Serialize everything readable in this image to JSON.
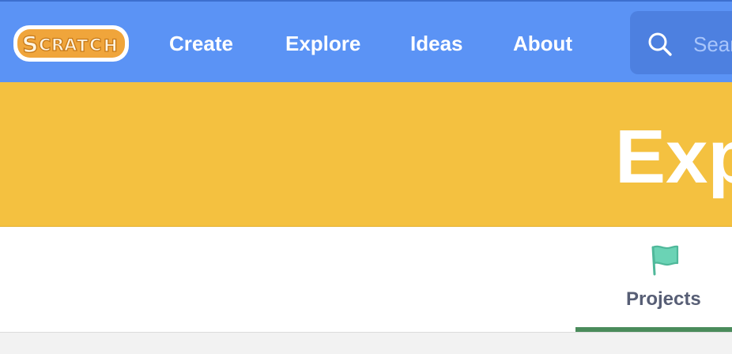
{
  "header": {
    "logo_text": "SCRATCH",
    "nav": {
      "create": "Create",
      "explore": "Explore",
      "ideas": "Ideas",
      "about": "About"
    },
    "search": {
      "placeholder_visible": "Sear"
    }
  },
  "banner": {
    "title_visible": "Exp"
  },
  "tabs": {
    "projects_label": "Projects",
    "active": "Projects"
  },
  "colors": {
    "navbar": "#5b93f5",
    "banner": "#f4c140",
    "tab_text": "#575e75",
    "active_underline": "#4a8b5b",
    "flag_icon": "#6bd3b5",
    "logo_orange": "#f0a53b"
  },
  "icons": {
    "search": "search-icon",
    "flag": "flag-icon",
    "logo": "scratch-logo"
  }
}
